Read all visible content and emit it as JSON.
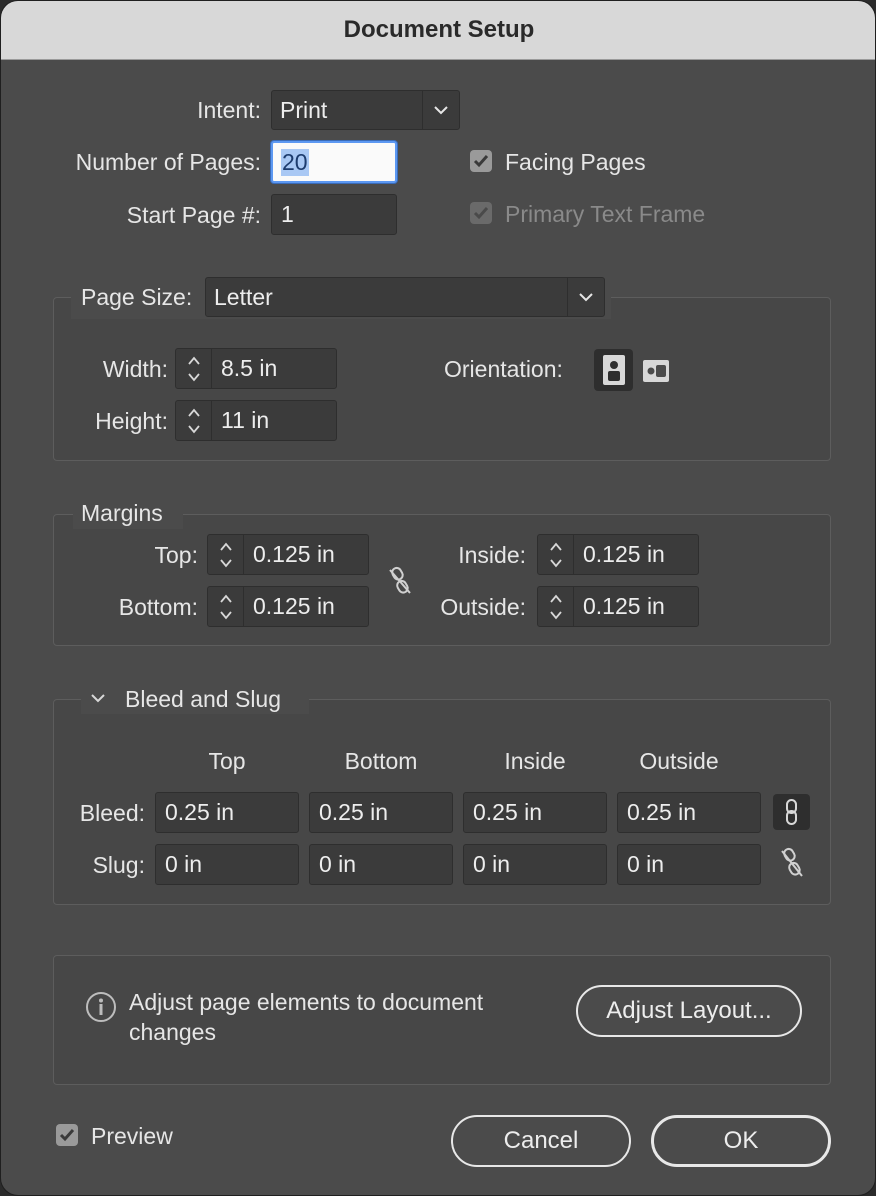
{
  "window": {
    "title": "Document Setup"
  },
  "intent": {
    "label": "Intent:",
    "value": "Print"
  },
  "pages": {
    "number_label": "Number of Pages:",
    "number_value": "20",
    "start_label": "Start Page #:",
    "start_value": "1",
    "facing_label": "Facing Pages",
    "facing_checked": true,
    "primary_label": "Primary Text Frame",
    "primary_checked": true
  },
  "page_size": {
    "label": "Page Size:",
    "value": "Letter",
    "width_label": "Width:",
    "width_value": "8.5 in",
    "height_label": "Height:",
    "height_value": "11 in",
    "orientation_label": "Orientation:"
  },
  "margins": {
    "title": "Margins",
    "top_label": "Top:",
    "top_value": "0.125 in",
    "bottom_label": "Bottom:",
    "bottom_value": "0.125 in",
    "inside_label": "Inside:",
    "inside_value": "0.125 in",
    "outside_label": "Outside:",
    "outside_value": "0.125 in"
  },
  "bleed_slug": {
    "title": "Bleed and Slug",
    "columns": [
      "Top",
      "Bottom",
      "Inside",
      "Outside"
    ],
    "bleed_label": "Bleed:",
    "bleed_values": [
      "0.25 in",
      "0.25 in",
      "0.25 in",
      "0.25 in"
    ],
    "slug_label": "Slug:",
    "slug_values": [
      "0 in",
      "0 in",
      "0 in",
      "0 in"
    ]
  },
  "adjust": {
    "text": "Adjust page elements to document changes",
    "line1": "Adjust page elements to document",
    "line2": "changes",
    "button": "Adjust Layout..."
  },
  "footer": {
    "preview_label": "Preview",
    "preview_checked": true,
    "cancel": "Cancel",
    "ok": "OK"
  }
}
